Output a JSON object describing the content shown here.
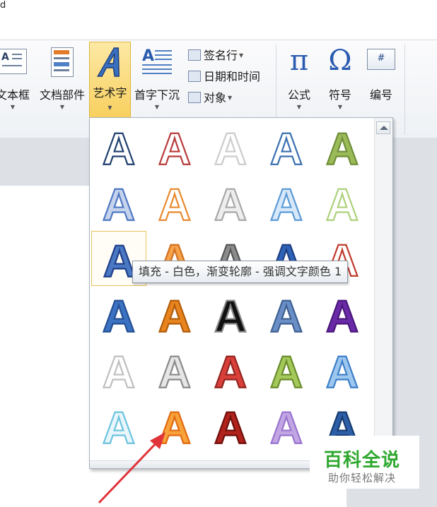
{
  "topline": "d",
  "ribbon": {
    "text_group": [
      {
        "name": "textbox",
        "label": "文本框"
      },
      {
        "name": "quick-parts",
        "label": "文档部件"
      },
      {
        "name": "wordart",
        "label": "艺术字"
      },
      {
        "name": "drop-cap",
        "label": "首字下沉"
      }
    ],
    "small_items": [
      {
        "name": "signature-line",
        "label": "签名行",
        "has_dropdown": true
      },
      {
        "name": "date-time",
        "label": "日期和时间",
        "has_dropdown": false
      },
      {
        "name": "object",
        "label": "对象",
        "has_dropdown": true
      }
    ],
    "symbols_group": [
      {
        "name": "equation",
        "label": "公式",
        "glyph": "π"
      },
      {
        "name": "symbol",
        "label": "符号",
        "glyph": "Ω"
      },
      {
        "name": "number",
        "label": "编号",
        "glyph": "#"
      }
    ],
    "active": "wordart"
  },
  "gallery": {
    "tile_glyph": "A",
    "rows": [
      [
        "outline-blue",
        "outline-red",
        "outline-white",
        "outline-lightblue",
        "green-shadow"
      ],
      [
        "blue-glow",
        "orange-outline",
        "grey-gradient",
        "lightblue-gradient",
        "lightgreen-glow"
      ],
      [
        "white-gradient-blue",
        "orange-gradient",
        "grey-gradient-dark",
        "blue-gradient",
        "red-outline"
      ],
      [
        "blue-fill",
        "orange-fill",
        "black-outline",
        "steelblue-fill",
        "purple-reflect"
      ],
      [
        "white-outline",
        "silver-3d",
        "red-3d",
        "green-3d",
        "blue-reflect"
      ],
      [
        "cyan-outline",
        "orange-bright",
        "darkred-fill",
        "lavender-glow",
        "blue-bevel"
      ]
    ],
    "selected": {
      "row": 2,
      "col": 0
    },
    "tooltip": "填充 - 白色，渐变轮廓 - 强调文字颜色 1"
  },
  "styles": {
    "outline-blue": {
      "fill": "#ffffff",
      "stroke": "#1f3f6e"
    },
    "outline-red": {
      "fill": "#ffffff",
      "stroke": "#b83b3b"
    },
    "outline-white": {
      "fill": "#ffffff",
      "stroke": "#cccccc"
    },
    "outline-lightblue": {
      "fill": "#ffffff",
      "stroke": "#3a6fb0"
    },
    "green-shadow": {
      "fill": "#9bbb59",
      "stroke": "#6f8f3a"
    },
    "blue-glow": {
      "fill": "#c6d3ec",
      "stroke": "#4f78c4"
    },
    "orange-outline": {
      "fill": "#ffffff",
      "stroke": "#e88a2e"
    },
    "grey-gradient": {
      "fill": "#eeeeee",
      "stroke": "#a8a8a8"
    },
    "lightblue-gradient": {
      "fill": "#d8e8fb",
      "stroke": "#5b9bd5"
    },
    "lightgreen-glow": {
      "fill": "#ffffff",
      "stroke": "#aed17c"
    },
    "white-gradient-blue": {
      "fill": "#4a78c2",
      "stroke": "#1f3f8a"
    },
    "orange-gradient": {
      "fill": "#f6a24b",
      "stroke": "#d27120"
    },
    "grey-gradient-dark": {
      "fill": "#8c8c8c",
      "stroke": "#555555"
    },
    "blue-gradient": {
      "fill": "#2f63b8",
      "stroke": "#1d3f80"
    },
    "red-outline": {
      "fill": "#ffffff",
      "stroke": "#c0392b"
    },
    "blue-fill": {
      "fill": "#3c72c2",
      "stroke": "#244f94"
    },
    "orange-fill": {
      "fill": "#e8841e",
      "stroke": "#b35c0a"
    },
    "black-outline": {
      "fill": "#111111",
      "stroke": "#888888"
    },
    "steelblue-fill": {
      "fill": "#6a8fc7",
      "stroke": "#3e5f91"
    },
    "purple-reflect": {
      "fill": "#6a2aa8",
      "stroke": "#4a167c"
    },
    "white-outline": {
      "fill": "#ffffff",
      "stroke": "#bfbfbf"
    },
    "silver-3d": {
      "fill": "#e6e6e6",
      "stroke": "#8a8a8a"
    },
    "red-3d": {
      "fill": "#d9403a",
      "stroke": "#932520"
    },
    "green-3d": {
      "fill": "#a5c85a",
      "stroke": "#6a8d2c"
    },
    "blue-reflect": {
      "fill": "#9dc7ef",
      "stroke": "#3d7fc7"
    },
    "cyan-outline": {
      "fill": "#e8f6fb",
      "stroke": "#6cc3de"
    },
    "orange-bright": {
      "fill": "#f7a23a",
      "stroke": "#e26a12"
    },
    "darkred-fill": {
      "fill": "#b0221c",
      "stroke": "#6e0f0b"
    },
    "lavender-glow": {
      "fill": "#c2a6e4",
      "stroke": "#9a74cf"
    },
    "blue-bevel": {
      "fill": "#2c5fa8",
      "stroke": "#183c72"
    }
  },
  "watermark": {
    "title": "百科全说",
    "subtitle": "助你轻松解决"
  },
  "colors": {
    "ribbon_active": "#f8d05f",
    "arrow": "#e0343a",
    "watermark_green": "#2fa82f"
  }
}
